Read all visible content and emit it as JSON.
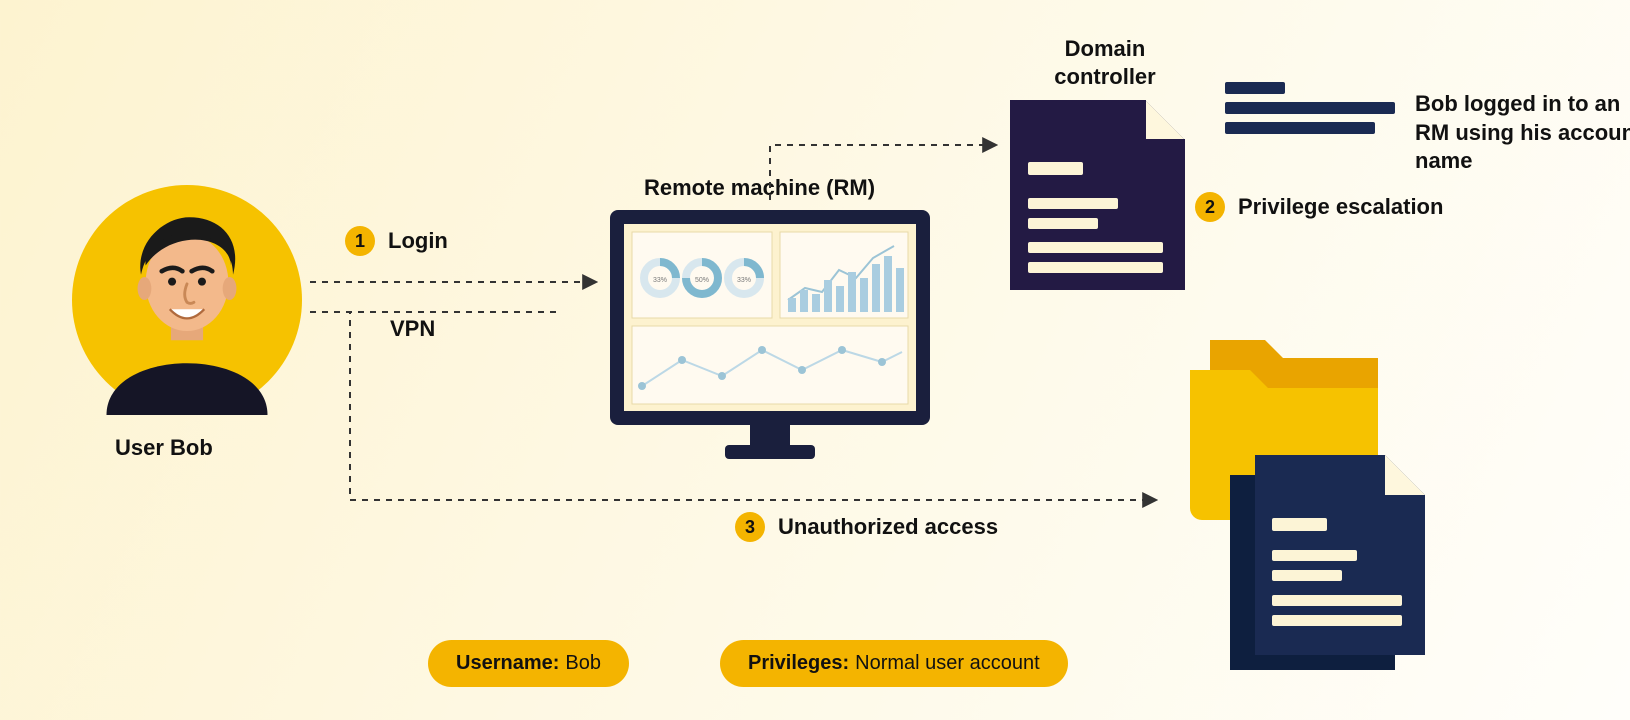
{
  "user": {
    "label": "User Bob"
  },
  "steps": {
    "one": {
      "num": "1",
      "label": "Login"
    },
    "vpn": {
      "label": "VPN"
    },
    "two": {
      "num": "2",
      "label": "Privilege escalation"
    },
    "three": {
      "num": "3",
      "label": "Unauthorized access"
    }
  },
  "remote_machine": {
    "label": "Remote machine (RM)"
  },
  "domain_controller": {
    "label": "Domain\ncontroller"
  },
  "log_caption": "Bob logged in to an RM using his account name",
  "badges": {
    "username_key": "Username:",
    "username_val": "Bob",
    "privileges_key": "Privileges:",
    "privileges_val": "Normal user account"
  }
}
